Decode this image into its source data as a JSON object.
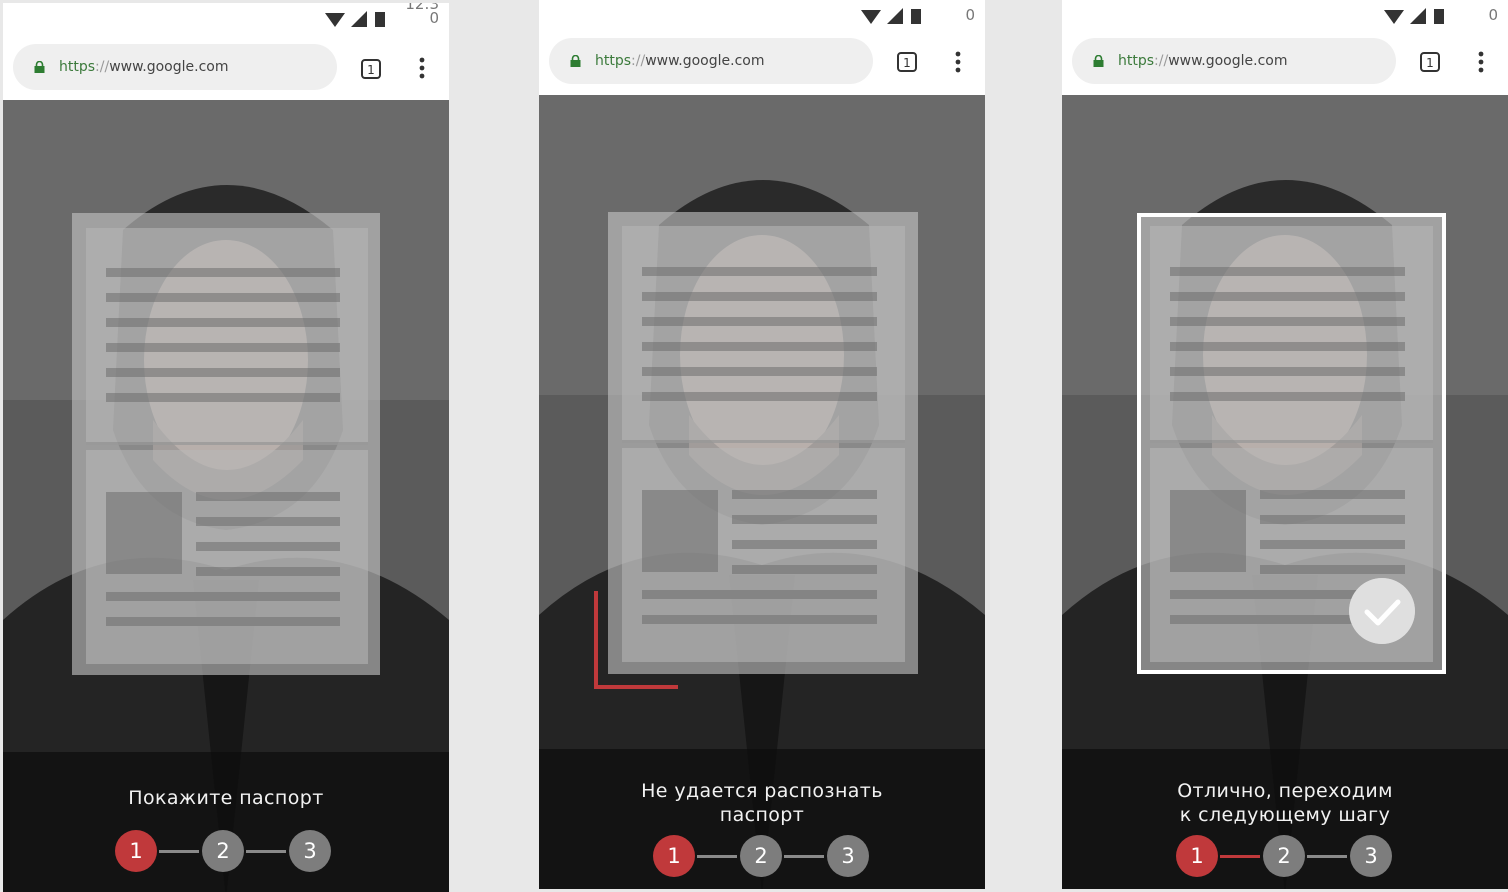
{
  "browser": {
    "url_scheme": "https",
    "url_separator": "://",
    "url_host": "www.google.com",
    "tab_count": "1"
  },
  "statusbar": {
    "clock_fragment": "12:3",
    "counter": "0",
    "icons": [
      "wifi-icon",
      "signal-icon",
      "battery-icon"
    ]
  },
  "steps": [
    "1",
    "2",
    "3"
  ],
  "screens": [
    {
      "message_line1": "Покажите паспорт",
      "message_line2": "",
      "state": "waiting"
    },
    {
      "message_line1": "Не удается распознать",
      "message_line2": "паспорт",
      "state": "not-recognized"
    },
    {
      "message_line1": "Отлично, переходим",
      "message_line2": "к следующему шагу",
      "state": "recognized"
    }
  ],
  "colors": {
    "accent_red": "#c0393b",
    "step_inactive": "#7d7d7d",
    "url_green": "#3b7a3b",
    "panel_dark": "#0e0e0e"
  }
}
